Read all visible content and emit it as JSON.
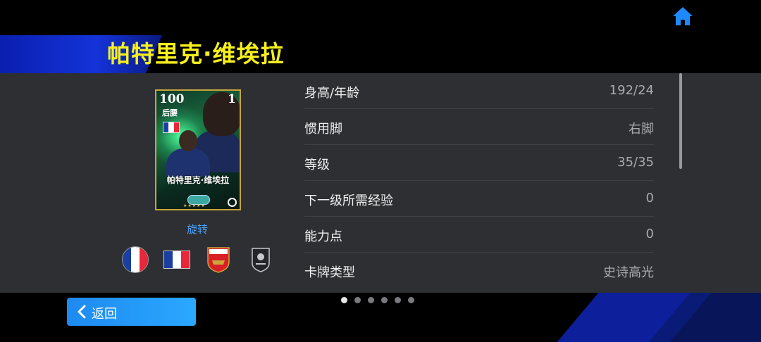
{
  "header": {
    "player_name": "帕特里克·维埃拉"
  },
  "card": {
    "rating": "100",
    "position": "后腰",
    "rank": "1",
    "name": "帕特里克·维埃拉",
    "flag_colors": [
      "#1b3fa0",
      "#ffffff",
      "#e8283a"
    ]
  },
  "rotate_label": "旋转",
  "icons": [
    "france-circle-flag-icon",
    "france-flag-icon",
    "arsenal-crest-icon",
    "english-league-icon"
  ],
  "stats": [
    {
      "label": "身高/年龄",
      "value": "192/24"
    },
    {
      "label": "惯用脚",
      "value": "右脚"
    },
    {
      "label": "等级",
      "value": "35/35"
    },
    {
      "label": "下一级所需经验",
      "value": "0"
    },
    {
      "label": "能力点",
      "value": "0"
    },
    {
      "label": "卡牌类型",
      "value": "史诗高光"
    }
  ],
  "pagination": {
    "total": 6,
    "active": 1
  },
  "back_button": {
    "label": "返回"
  },
  "colors": {
    "accent": "#2aa8ff",
    "title": "#f7f01c",
    "panel": "#2e2f33"
  }
}
